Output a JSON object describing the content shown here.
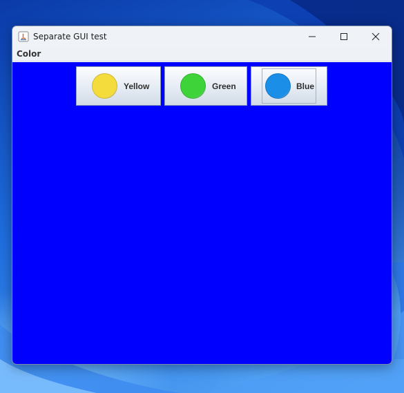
{
  "window": {
    "title": "Separate GUI test",
    "menu": [
      "Color"
    ]
  },
  "colors": {
    "content_background": "#0000ff",
    "yellow": "#f4dc3c",
    "green": "#3fd33a",
    "blue": "#1b8ee8"
  },
  "buttons": [
    {
      "label": "Yellow",
      "icon": "yellow-circle-icon"
    },
    {
      "label": "Green",
      "icon": "green-circle-icon"
    },
    {
      "label": "Blue",
      "icon": "blue-circle-icon"
    }
  ]
}
